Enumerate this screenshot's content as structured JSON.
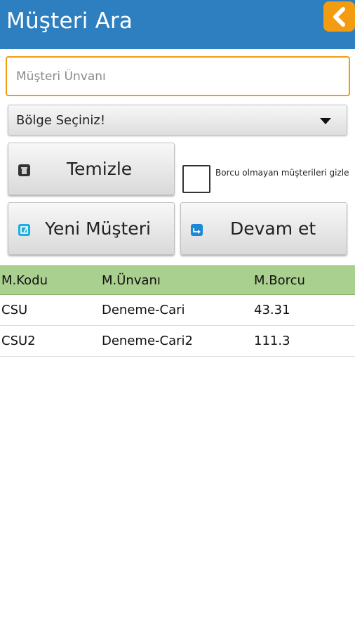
{
  "header": {
    "title": "Müşteri Ara",
    "back_icon": "chevron-left-icon",
    "accent": "#f39c12",
    "bar_color": "#2e7fc0"
  },
  "search": {
    "placeholder": "Müşteri Ünvanı",
    "value": ""
  },
  "region": {
    "selected": "Bölge Seçiniz!"
  },
  "buttons": {
    "clear_label": "Temizle",
    "clear_icon": "trash-icon",
    "new_label": "Yeni Müşteri",
    "new_icon": "new-customer-icon",
    "continue_label": "Devam et",
    "continue_icon": "forward-icon"
  },
  "filter": {
    "hide_no_debt_label": "Borcu olmayan müşterileri gizle",
    "checked": false
  },
  "table": {
    "header_color": "#a9d08e",
    "columns": [
      "M.Kodu",
      "M.Ünvanı",
      "M.Borcu"
    ],
    "rows": [
      [
        "CSU",
        "Deneme-Cari",
        "43.31"
      ],
      [
        "CSU2",
        "Deneme-Cari2",
        "111.3"
      ]
    ]
  }
}
